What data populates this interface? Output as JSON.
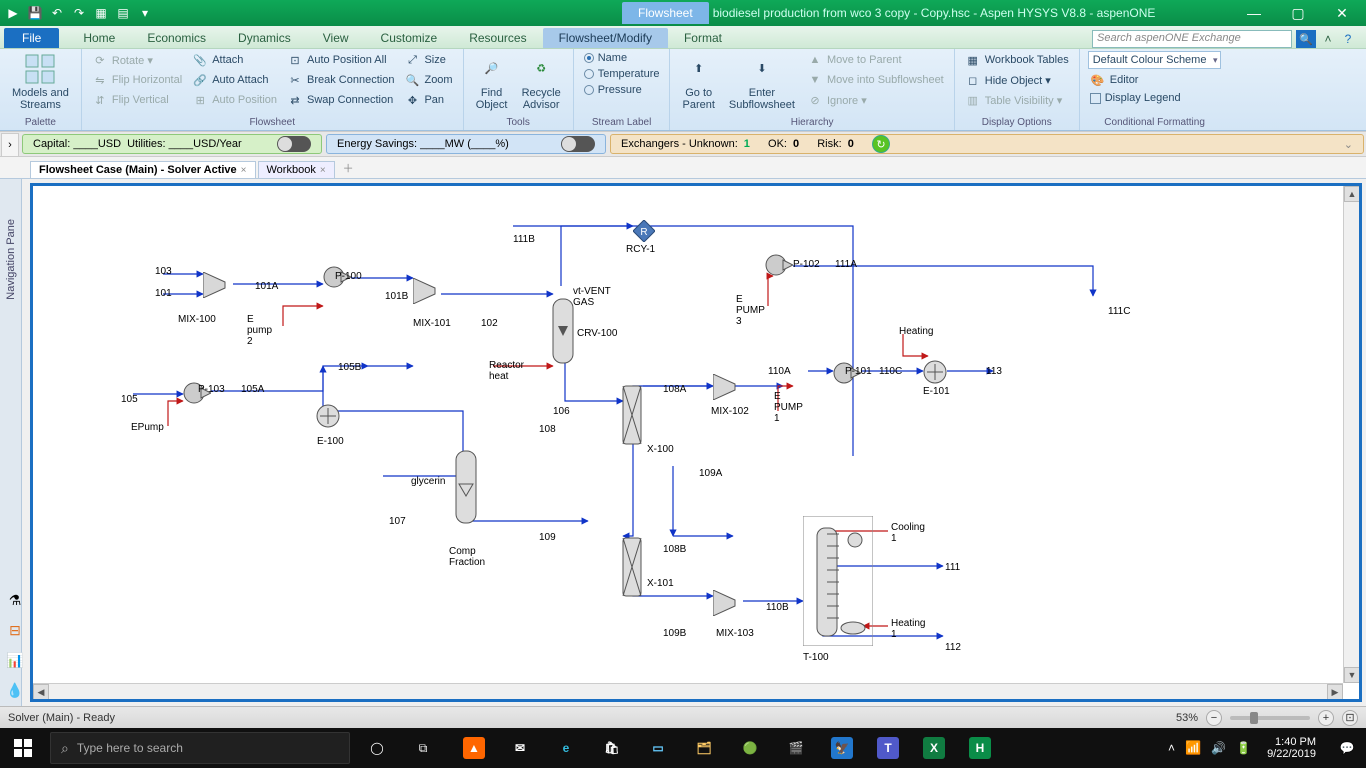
{
  "app": {
    "title_doc": "biodiesel production from wco 3 copy - Copy.hsc",
    "title_app": "Aspen HYSYS V8.8 - aspenONE",
    "context_tab": "Flowsheet"
  },
  "ribbon_tabs": {
    "file": "File",
    "items": [
      "Home",
      "Economics",
      "Dynamics",
      "View",
      "Customize",
      "Resources",
      "Flowsheet/Modify",
      "Format"
    ],
    "active_index": 6
  },
  "search": {
    "placeholder": "Search aspenONE Exchange"
  },
  "ribbon": {
    "palette": {
      "large": "Models and\nStreams",
      "label": "Palette"
    },
    "flowsheet_group": {
      "col1": [
        "Rotate ▾",
        "Flip Horizontal",
        "Flip Vertical"
      ],
      "col2": [
        "Attach",
        "Auto Attach",
        "Auto Position"
      ],
      "col3": [
        "Auto Position All",
        "Break Connection",
        "Swap Connection"
      ],
      "col4": [
        "Size",
        "Zoom",
        "Pan"
      ],
      "label": "Flowsheet"
    },
    "tools": {
      "find": "Find\nObject",
      "recycle": "Recycle\nAdvisor",
      "label": "Tools"
    },
    "stream_label": {
      "options": [
        "Name",
        "Temperature",
        "Pressure"
      ],
      "selected_index": 0,
      "label": "Stream Label"
    },
    "hierarchy": {
      "goto": "Go to\nParent",
      "enter": "Enter\nSubflowsheet",
      "col": [
        "Move to Parent",
        "Move into Subflowsheet",
        "Ignore ▾"
      ],
      "label": "Hierarchy"
    },
    "display": {
      "top": "Workbook Tables",
      "col": [
        "Hide Object ▾",
        "Table Visibility ▾"
      ],
      "label": "Display Options"
    },
    "cond": {
      "combo": "Default Colour Scheme",
      "btns": [
        "Editor",
        "Display Legend"
      ],
      "label": "Conditional Formatting"
    }
  },
  "summary": {
    "capital": "Capital: ____USD",
    "utilities": "Utilities: ____USD/Year",
    "energy": "Energy Savings: ____MW  (____%)",
    "exch_label": "Exchangers - Unknown:",
    "exch_unknown": "1",
    "ok_label": "OK:",
    "ok": "0",
    "risk_label": "Risk:",
    "risk": "0"
  },
  "doc_tabs": {
    "tab1": "Flowsheet Case (Main) - Solver Active",
    "tab2": "Workbook"
  },
  "nav_pane": "Navigation Pane",
  "statusbar": {
    "left": "Solver (Main) - Ready",
    "zoom": "53%"
  },
  "taskbar": {
    "search_placeholder": "Type here to search",
    "time": "1:40 PM",
    "date": "9/22/2019"
  },
  "flowsheet": {
    "streams": [
      "103",
      "101",
      "101A",
      "101B",
      "102",
      "105",
      "105A",
      "105B",
      "106",
      "107",
      "108",
      "108A",
      "108B",
      "109",
      "109A",
      "109B",
      "110A",
      "110B",
      "110C",
      "111",
      "111A",
      "111B",
      "111C",
      "112",
      "113"
    ],
    "energy_streams": [
      "E pump 2",
      "EPump",
      "E PUMP 3",
      "E PUMP 1",
      "Reactor heat",
      "Heating",
      "Cooling 1",
      "Heating 1",
      "glycerin",
      "Comp Fraction",
      "vt-VENT GAS"
    ],
    "units": {
      "MIX-100": "Mixer",
      "MIX-101": "Mixer",
      "MIX-102": "Mixer",
      "MIX-103": "Mixer",
      "P-100": "Pump",
      "P-101": "Pump",
      "P-102": "Pump",
      "P-103": "Pump",
      "E-100": "Heater",
      "E-101": "Heater",
      "CRV-100": "Conversion Reactor",
      "X-100": "Component Splitter",
      "X-101": "Component Splitter",
      "T-100": "Distillation Column",
      "RCY-1": "Recycle"
    },
    "labels": {
      "s103": "103",
      "s101": "101",
      "s101A": "101A",
      "s101B": "101B",
      "s102": "102",
      "s105": "105",
      "s105A": "105A",
      "s105B": "105B",
      "s106": "106",
      "s107": "107",
      "s108": "108",
      "s108A": "108A",
      "s108B": "108B",
      "s109": "109",
      "s109A": "109A",
      "s109B": "109B",
      "s110A": "110A",
      "s110B": "110B",
      "s110C": "110C",
      "s111": "111",
      "s111A": "111A",
      "s111B": "111B",
      "s111C": "111C",
      "s112": "112",
      "s113": "113",
      "mix100": "MIX-100",
      "mix101": "MIX-101",
      "mix102": "MIX-102",
      "mix103": "MIX-103",
      "p100": "P-100",
      "p101": "P-101",
      "p102": "P-102",
      "p103": "P-103",
      "e100": "E-100",
      "e101": "E-101",
      "crv": "CRV-100",
      "x100": "X-100",
      "x101": "X-101",
      "t100": "T-100",
      "rcy": "RCY-1",
      "epump2": "E\npump\n2",
      "epump": "EPump",
      "epump3": "E\nPUMP\n3",
      "epump1": "E\nPUMP\n1",
      "rheat": "Reactor\nheat",
      "heating": "Heating",
      "cooling1": "Cooling\n1",
      "heating1": "Heating\n1",
      "glycerin": "glycerin",
      "compfrac": "Comp\nFraction",
      "vtvent": "vt-VENT\nGAS"
    }
  }
}
